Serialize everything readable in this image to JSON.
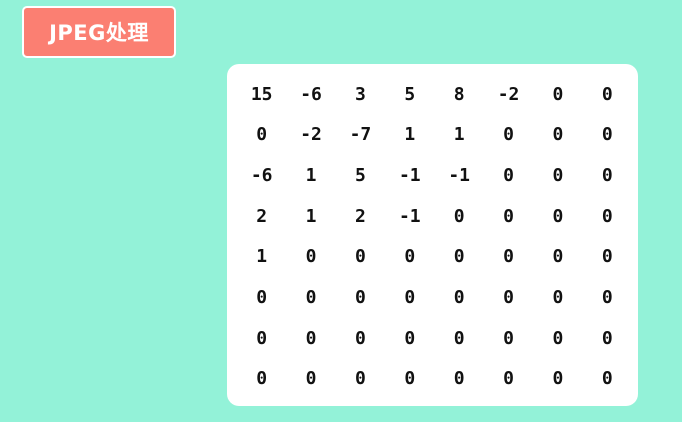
{
  "title": "JPEG处理",
  "colors": {
    "background": "#93f2d8",
    "badge": "#fb7f72",
    "card": "#ffffff",
    "text": "#111111"
  },
  "matrix": [
    [
      "15",
      "-6",
      "3",
      "5",
      "8",
      "-2",
      "0",
      "0"
    ],
    [
      "0",
      "-2",
      "-7",
      "1",
      "1",
      "0",
      "0",
      "0"
    ],
    [
      "-6",
      "1",
      "5",
      "-1",
      "-1",
      "0",
      "0",
      "0"
    ],
    [
      "2",
      "1",
      "2",
      "-1",
      "0",
      "0",
      "0",
      "0"
    ],
    [
      "1",
      "0",
      "0",
      "0",
      "0",
      "0",
      "0",
      "0"
    ],
    [
      "0",
      "0",
      "0",
      "0",
      "0",
      "0",
      "0",
      "0"
    ],
    [
      "0",
      "0",
      "0",
      "0",
      "0",
      "0",
      "0",
      "0"
    ],
    [
      "0",
      "0",
      "0",
      "0",
      "0",
      "0",
      "0",
      "0"
    ]
  ]
}
